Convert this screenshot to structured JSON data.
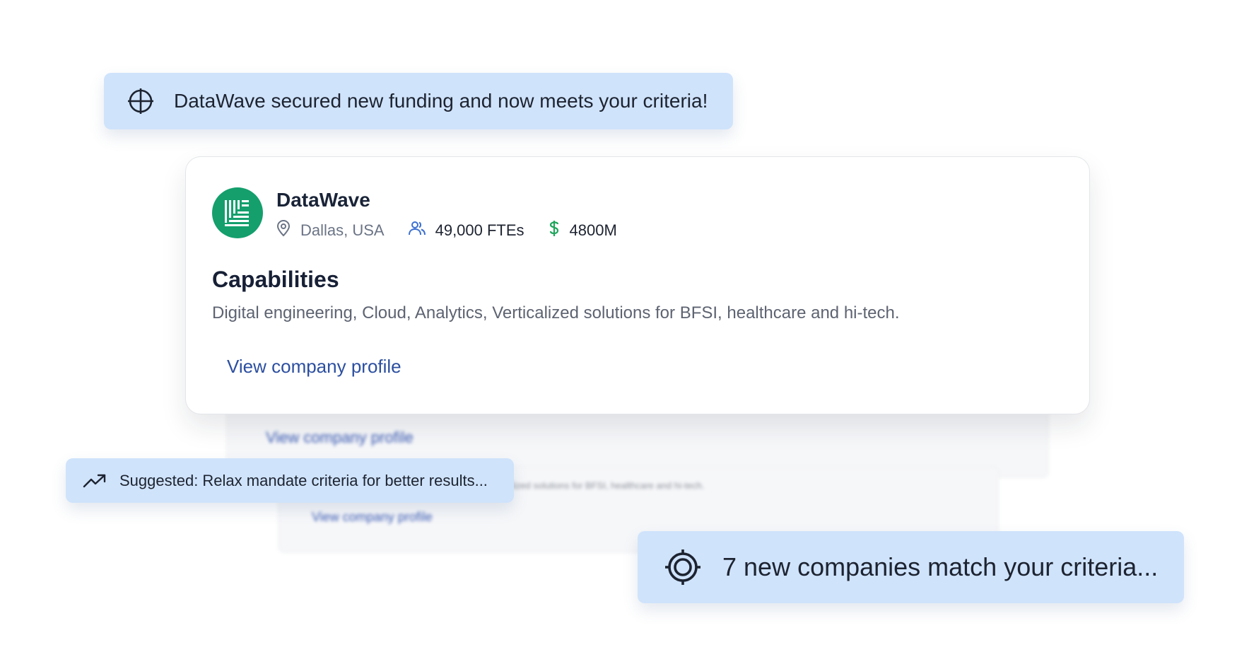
{
  "notifications": {
    "funding": {
      "text": "DataWave secured new funding and now meets your criteria!",
      "icon": "crosshair-circle-icon"
    },
    "suggestion": {
      "text": "Suggested: Relax mandate criteria for better results...",
      "icon": "trending-up-icon"
    },
    "match": {
      "text": "7 new companies match your criteria...",
      "icon": "target-icon"
    }
  },
  "company_card": {
    "name": "DataWave",
    "location": "Dallas, USA",
    "employees": "49,000 FTEs",
    "revenue": "4800M",
    "capabilities_title": "Capabilities",
    "capabilities_text": "Digital engineering, Cloud, Analytics, Verticalized solutions for BFSI, healthcare and hi-tech.",
    "profile_link": "View company profile"
  },
  "background_cards": [
    {
      "link": "View company profile"
    },
    {
      "link": "View company profile",
      "text": "lized solutions for BFSI, healthcare and hi-tech."
    }
  ],
  "colors": {
    "toast_bg": "#cfe3fb",
    "logo_green": "#149f6d",
    "link_blue": "#2c4fa0",
    "revenue_green": "#1fa55b",
    "people_blue": "#3b6fd1"
  }
}
